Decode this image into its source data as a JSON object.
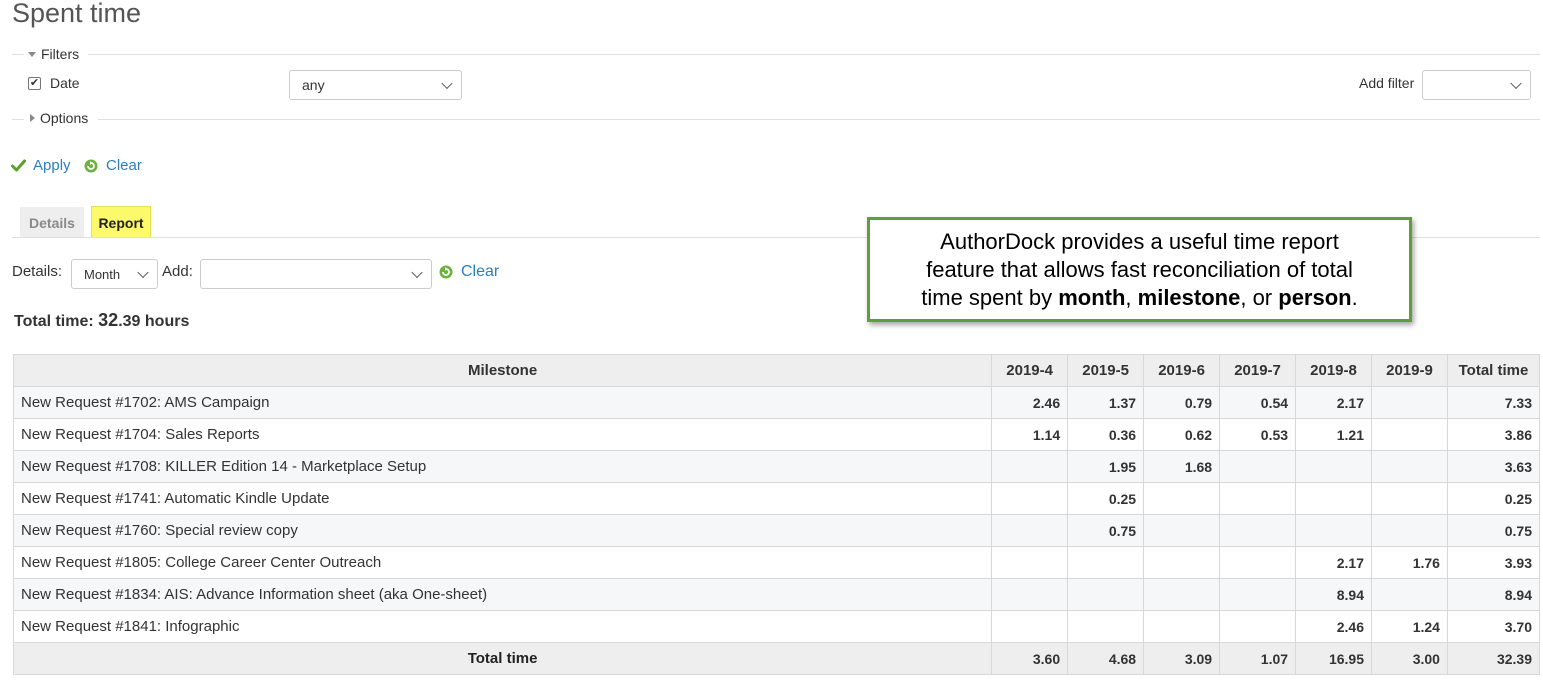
{
  "page": {
    "title": "Spent time"
  },
  "filters": {
    "legend": "Filters",
    "date_label": "Date",
    "date_operator": "any",
    "add_filter_label": "Add filter",
    "add_filter_value": ""
  },
  "options": {
    "legend": "Options"
  },
  "actions": {
    "apply_label": "Apply",
    "clear_label": "Clear"
  },
  "tabs": [
    {
      "label": "Details",
      "active": false
    },
    {
      "label": "Report",
      "active": true
    }
  ],
  "report_controls": {
    "details_label": "Details:",
    "details_value": "Month",
    "add_label": "Add:",
    "add_value": "",
    "clear_label": "Clear"
  },
  "callout": {
    "line1": "AuthorDock provides a useful time report",
    "line2": "feature that allows fast reconciliation of total",
    "line3_prefix": "time spent by ",
    "bold1": "month",
    "sep1": ", ",
    "bold2": "milestone",
    "sep2": ", or ",
    "bold3": "person",
    "end": "."
  },
  "total_time": {
    "label": "Total time:",
    "value_int": "32",
    "value_dec": ".39",
    "unit": "hours"
  },
  "table": {
    "headers": [
      "Milestone",
      "2019-4",
      "2019-5",
      "2019-6",
      "2019-7",
      "2019-8",
      "2019-9",
      "Total time"
    ],
    "rows": [
      [
        "New Request #1702: AMS Campaign",
        "2.46",
        "1.37",
        "0.79",
        "0.54",
        "2.17",
        "",
        "7.33"
      ],
      [
        "New Request #1704: Sales Reports",
        "1.14",
        "0.36",
        "0.62",
        "0.53",
        "1.21",
        "",
        "3.86"
      ],
      [
        "New Request #1708: KILLER Edition 14 - Marketplace Setup",
        "",
        "1.95",
        "1.68",
        "",
        "",
        "",
        "3.63"
      ],
      [
        "New Request #1741: Automatic Kindle Update",
        "",
        "0.25",
        "",
        "",
        "",
        "",
        "0.25"
      ],
      [
        "New Request #1760: Special review copy",
        "",
        "0.75",
        "",
        "",
        "",
        "",
        "0.75"
      ],
      [
        "New Request #1805: College Career Center Outreach",
        "",
        "",
        "",
        "",
        "2.17",
        "1.76",
        "3.93"
      ],
      [
        "New Request #1834: AIS: Advance Information sheet (aka One-sheet)",
        "",
        "",
        "",
        "",
        "8.94",
        "",
        "8.94"
      ],
      [
        "New Request #1841: Infographic",
        "",
        "",
        "",
        "",
        "2.46",
        "1.24",
        "3.70"
      ]
    ],
    "totals": [
      "Total time",
      "3.60",
      "4.68",
      "3.09",
      "1.07",
      "16.95",
      "3.00",
      "32.39"
    ]
  },
  "colors": {
    "link": "#2a7fc0",
    "active_tab": "#fcf96b",
    "callout_border": "#5f9e3a",
    "check_green": "#5aa02c"
  }
}
